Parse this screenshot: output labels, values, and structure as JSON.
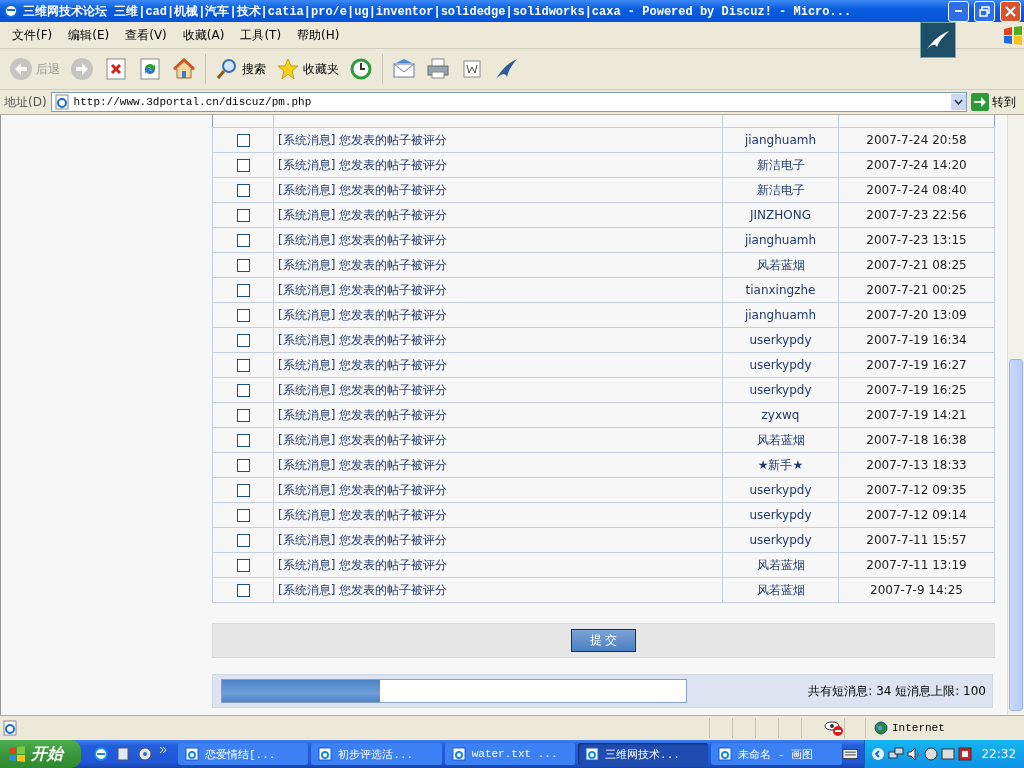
{
  "window": {
    "title": "三维网技术论坛 三维|cad|机械|汽车|技术|catia|pro/e|ug|inventor|solidedge|solidworks|caxa - Powered by Discuz! - Micro..."
  },
  "menu": [
    "文件(F)",
    "编辑(E)",
    "查看(V)",
    "收藏(A)",
    "工具(T)",
    "帮助(H)"
  ],
  "toolbar": [
    {
      "kind": "back",
      "label": "后退",
      "disabled": true
    },
    {
      "kind": "forward",
      "disabled": true
    },
    {
      "kind": "stop"
    },
    {
      "kind": "refresh"
    },
    {
      "kind": "home"
    },
    {
      "kind": "search",
      "label": "搜索"
    },
    {
      "kind": "favorites",
      "label": "收藏夹"
    },
    {
      "kind": "history"
    },
    {
      "kind": "mail"
    },
    {
      "kind": "print"
    },
    {
      "kind": "edit"
    },
    {
      "kind": "messenger"
    }
  ],
  "address": {
    "label": "地址(D)",
    "value": "http://www.3dportal.cn/discuz/pm.php",
    "go": "转到"
  },
  "rows": [
    {
      "checked": false,
      "subject": "[系统消息] 您发表的帖子被评分",
      "from": "jianghuamh",
      "date": "2007-7-24 20:58"
    },
    {
      "checked": false,
      "subject": "[系统消息] 您发表的帖子被评分",
      "from": "新洁电子",
      "date": "2007-7-24 14:20"
    },
    {
      "checked": false,
      "subject": "[系统消息] 您发表的帖子被评分",
      "from": "新洁电子",
      "date": "2007-7-24 08:40"
    },
    {
      "checked": false,
      "subject": "[系统消息] 您发表的帖子被评分",
      "from": "JINZHONG",
      "date": "2007-7-23 22:56"
    },
    {
      "checked": false,
      "subject": "[系统消息] 您发表的帖子被评分",
      "from": "jianghuamh",
      "date": "2007-7-23 13:15"
    },
    {
      "checked": false,
      "subject": "[系统消息] 您发表的帖子被评分",
      "from": "风若蓝烟",
      "date": "2007-7-21 08:25"
    },
    {
      "checked": false,
      "subject": "[系统消息] 您发表的帖子被评分",
      "from": "tianxingzhe",
      "date": "2007-7-21 00:25"
    },
    {
      "checked": false,
      "subject": "[系统消息] 您发表的帖子被评分",
      "from": "jianghuamh",
      "date": "2007-7-20 13:09"
    },
    {
      "checked": false,
      "subject": "[系统消息] 您发表的帖子被评分",
      "from": "userkypdy",
      "date": "2007-7-19 16:34"
    },
    {
      "checked": false,
      "subject": "[系统消息] 您发表的帖子被评分",
      "from": "userkypdy",
      "date": "2007-7-19 16:27"
    },
    {
      "checked": false,
      "subject": "[系统消息] 您发表的帖子被评分",
      "from": "userkypdy",
      "date": "2007-7-19 16:25"
    },
    {
      "checked": false,
      "subject": "[系统消息] 您发表的帖子被评分",
      "from": "zyxwq",
      "date": "2007-7-19 14:21"
    },
    {
      "checked": false,
      "subject": "[系统消息] 您发表的帖子被评分",
      "from": "风若蓝烟",
      "date": "2007-7-18 16:38"
    },
    {
      "checked": false,
      "subject": "[系统消息] 您发表的帖子被评分",
      "from": "★新手★",
      "date": "2007-7-13 18:33"
    },
    {
      "checked": false,
      "subject": "[系统消息] 您发表的帖子被评分",
      "from": "userkypdy",
      "date": "2007-7-12 09:35"
    },
    {
      "checked": false,
      "subject": "[系统消息] 您发表的帖子被评分",
      "from": "userkypdy",
      "date": "2007-7-12 09:14"
    },
    {
      "checked": false,
      "subject": "[系统消息] 您发表的帖子被评分",
      "from": "userkypdy",
      "date": "2007-7-11 15:57"
    },
    {
      "checked": false,
      "subject": "[系统消息] 您发表的帖子被评分",
      "from": "风若蓝烟",
      "date": "2007-7-11 13:19"
    },
    {
      "checked": false,
      "subject": "[系统消息] 您发表的帖子被评分",
      "from": "风若蓝烟",
      "date": "2007-7-9 14:25"
    }
  ],
  "submit": "提 交",
  "quota": {
    "level": 0.34,
    "text": "共有短消息: 34 短消息上限: 100"
  },
  "status": {
    "zone": "Internet"
  },
  "taskbar": {
    "start": "开始",
    "tasks": [
      {
        "label": "恋爱情结[...",
        "selected": false
      },
      {
        "label": "初步评选活...",
        "selected": false
      },
      {
        "label": "water.txt ...",
        "selected": false
      },
      {
        "label": "三维网技术...",
        "selected": true
      },
      {
        "label": "未命名 - 画图",
        "selected": false
      }
    ],
    "clock": "22:32"
  }
}
